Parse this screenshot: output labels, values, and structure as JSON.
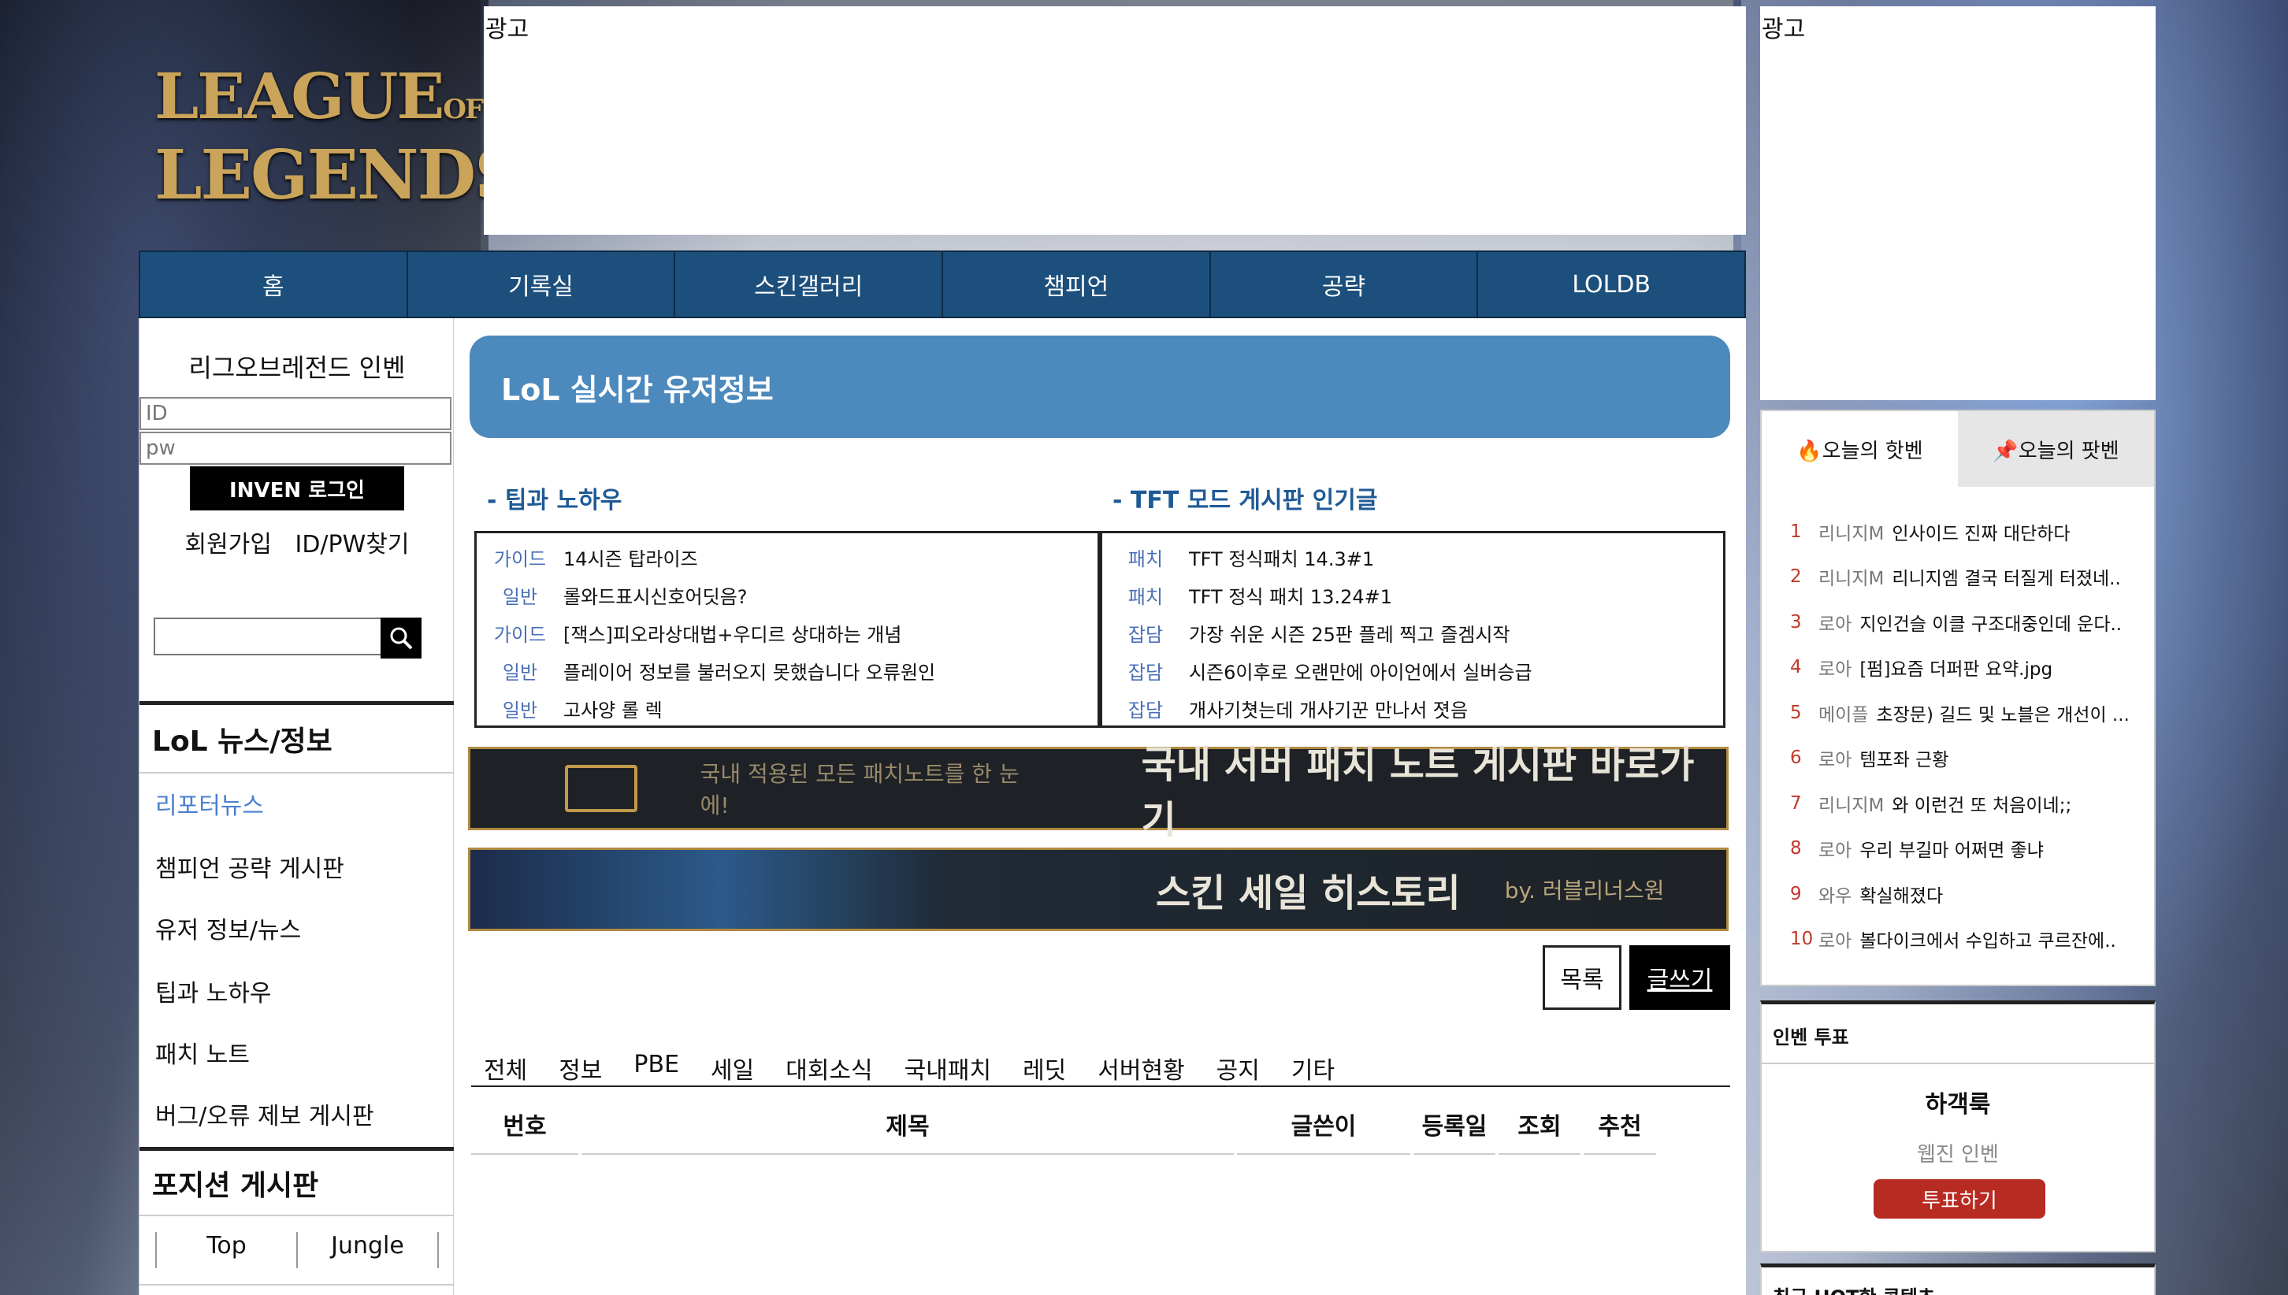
{
  "logo": {
    "line1": "LEAGUE",
    "line1_small": "OF",
    "line2": "LEGENDS"
  },
  "ads": {
    "top_label": "광고",
    "right_label": "광고"
  },
  "nav": {
    "items": [
      "홈",
      "기록실",
      "스킨갤러리",
      "챔피언",
      "공략",
      "LOLDB"
    ]
  },
  "sidebar": {
    "login_title": "리그오브레전드 인벤",
    "id_placeholder": "ID",
    "pw_placeholder": "pw",
    "login_button": "INVEN 로그인",
    "join_label": "회원가입",
    "find_label": "ID/PW찾기",
    "news_heading": "LoL 뉴스/정보",
    "news_links": [
      "리포터뉴스",
      "챔피언 공략 게시판",
      "유저 정보/뉴스",
      "팁과 노하우",
      "패치 노트",
      "버그/오류 제보 게시판"
    ],
    "position_heading": "포지션 게시판",
    "position_tabs": [
      "Top",
      "Jungle"
    ]
  },
  "main": {
    "banner_title": "LoL 실시간 유저정보",
    "tips": {
      "heading": "- 팁과 노하우",
      "posts": [
        {
          "cat": "가이드",
          "title": "14시즌 탑라이즈"
        },
        {
          "cat": "일반",
          "title": "롤와드표시신호어딧음?"
        },
        {
          "cat": "가이드",
          "title": "[잭스]피오라상대법+우디르 상대하는 개념"
        },
        {
          "cat": "일반",
          "title": "플레이어 정보를 불러오지 못했습니다 오류원인"
        },
        {
          "cat": "일반",
          "title": "고사양 롤 렉"
        }
      ]
    },
    "tft": {
      "heading": "- TFT 모드 게시판 인기글",
      "posts": [
        {
          "cat": "패치",
          "title": "TFT 정식패치 14.3#1"
        },
        {
          "cat": "패치",
          "title": "TFT 정식 패치 13.24#1"
        },
        {
          "cat": "잡담",
          "title": "가장 쉬운 시즌 25판 플레 찍고 즐겜시작"
        },
        {
          "cat": "잡담",
          "title": "시즌6이후로 오랜만에 아이언에서 실버승급"
        },
        {
          "cat": "잡담",
          "title": "개사기쳣는데 개사기꾼 만나서 졋음"
        }
      ]
    },
    "patch_banner": {
      "small": "국내 적용된 모든 패치노트를 한 눈에!",
      "big": "국내 서버 패치 노트 게시판 바로가기"
    },
    "skin_banner": {
      "big": "스킨 세일 히스토리",
      "small": "by. 러블리너스원"
    },
    "btn_list": "목록",
    "btn_write": "글쓰기",
    "category_tabs": [
      "전체",
      "정보",
      "PBE",
      "세일",
      "대회소식",
      "국내패치",
      "레딧",
      "서버현황",
      "공지",
      "기타"
    ],
    "table_headers": [
      "번호",
      "제목",
      "글쓴이",
      "등록일",
      "조회",
      "추천"
    ]
  },
  "hot": {
    "tab_hot": "🔥오늘의 핫벤",
    "tab_pot": "📌오늘의 팟벤",
    "items": [
      {
        "rank": "1",
        "source": "리니지M",
        "title": "인사이드 진짜 대단하다"
      },
      {
        "rank": "2",
        "source": "리니지M",
        "title": "리니지엠 결국 터질게 터졌네.."
      },
      {
        "rank": "3",
        "source": "로아",
        "title": "지인건슬 이클 구조대중인데 운다.."
      },
      {
        "rank": "4",
        "source": "로아",
        "title": "[펌]요즘 더퍼판 요약.jpg"
      },
      {
        "rank": "5",
        "source": "메이플",
        "title": "초장문) 길드 및 노블은 개선이 ..."
      },
      {
        "rank": "6",
        "source": "로아",
        "title": "템포좌 근황"
      },
      {
        "rank": "7",
        "source": "리니지M",
        "title": "와 이런건 또 처음이네;;"
      },
      {
        "rank": "8",
        "source": "로아",
        "title": "우리 부길마 어쩌면 좋냐"
      },
      {
        "rank": "9",
        "source": "와우",
        "title": "확실해졌다"
      },
      {
        "rank": "10",
        "source": "로아",
        "title": "볼다이크에서 수입하고 쿠르잔에.."
      }
    ]
  },
  "vote": {
    "title": "인벤 투표",
    "name": "하객룩",
    "sub": "웹진 인벤",
    "button": "투표하기"
  },
  "recent": {
    "title": "최근 HOT한 콘텐츠"
  }
}
